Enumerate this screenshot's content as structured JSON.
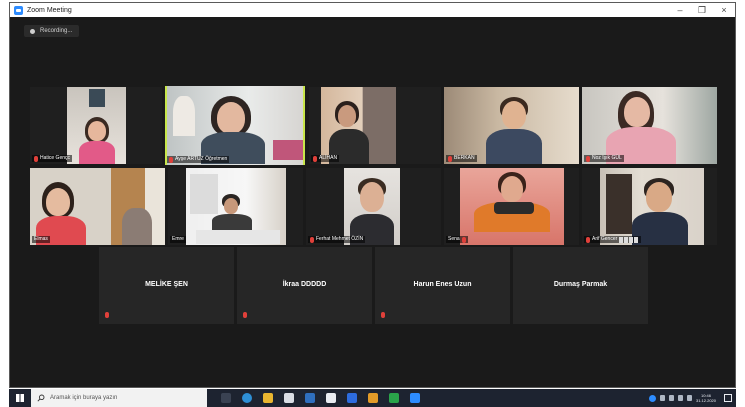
{
  "window": {
    "title": "Zoom Meeting",
    "minimize": "–",
    "maximize": "❐",
    "close": "×"
  },
  "recording": {
    "label": "Recording..."
  },
  "participants_video": [
    {
      "name": "Hatice Gençc"
    },
    {
      "name": "Ayşe ARTUZ Öğretmen"
    },
    {
      "name": "ALİHAN"
    },
    {
      "name": "BERKAN"
    },
    {
      "name": "Noz Işık GÜL"
    },
    {
      "name": "Elmas"
    },
    {
      "name": "Emre"
    },
    {
      "name": "Ferhat Mehmet ÖZİN"
    },
    {
      "name": "Sena"
    },
    {
      "name": "Arif Gencer"
    }
  ],
  "participants_name_only": [
    {
      "name": "MELİKE ŞEN"
    },
    {
      "name": "İkraa DDDDD"
    },
    {
      "name": "Harun Enes Uzun"
    },
    {
      "name": "Durmaş Parmak"
    }
  ],
  "taskbar": {
    "search_placeholder": "Aramak için buraya yazın",
    "time": "10:46",
    "date": "31.12.2020"
  },
  "icons": [
    "zoom-icon",
    "record-icon",
    "mic-muted-icon",
    "windows-start-icon",
    "search-icon"
  ],
  "colors": {
    "active_speaker": "#c8e64a",
    "mic_muted": "#e0403a",
    "zoom_blue": "#2d8cff"
  }
}
